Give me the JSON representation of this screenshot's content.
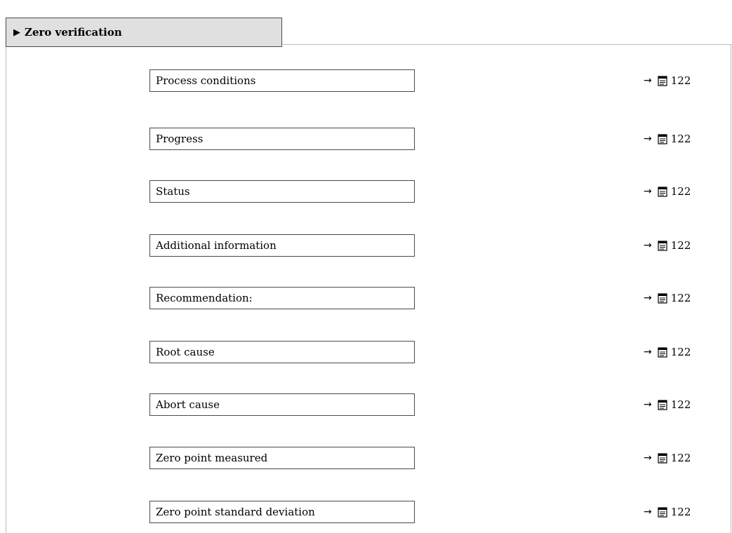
{
  "header": {
    "arrow": "▶",
    "title": "Zero verification"
  },
  "ref_arrow": "→",
  "parameters": [
    {
      "label": "Process conditions",
      "page": "122"
    },
    {
      "label": "Progress",
      "page": "122"
    },
    {
      "label": "Status",
      "page": "122"
    },
    {
      "label": "Additional information",
      "page": "122"
    },
    {
      "label": "Recommendation:",
      "page": "122"
    },
    {
      "label": "Root cause",
      "page": "122"
    },
    {
      "label": "Abort cause",
      "page": "122"
    },
    {
      "label": "Zero point measured",
      "page": "122"
    },
    {
      "label": "Zero point standard deviation",
      "page": "122"
    }
  ],
  "icons": {
    "reference": "book-page-icon"
  }
}
